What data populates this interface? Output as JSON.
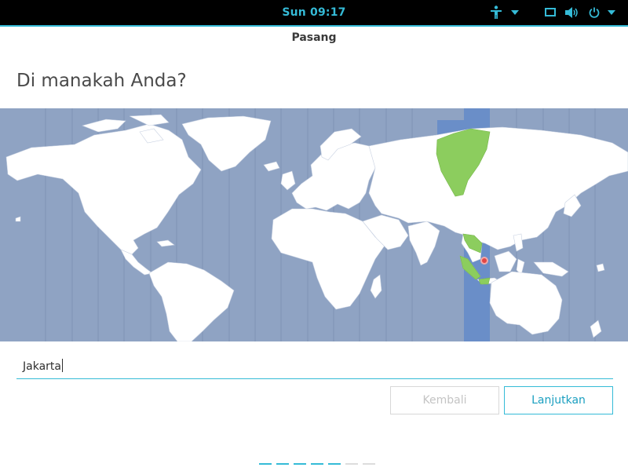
{
  "panel": {
    "clock": "Sun 09:17",
    "icons": [
      "accessibility-icon",
      "chevron-down-icon",
      "screen-icon",
      "volume-icon",
      "power-icon",
      "chevron-down-icon"
    ]
  },
  "window": {
    "title": "Pasang",
    "heading": "Di manakah Anda?"
  },
  "map": {
    "selected_zone_color": "#6a8ec8",
    "highlight_land_color": "#8ccd5e",
    "ocean_color": "#8fa3c3"
  },
  "search": {
    "value": "Jakarta"
  },
  "buttons": {
    "back": "Kembali",
    "next": "Lanjutkan"
  },
  "progress": {
    "total_steps": 7,
    "completed_steps": 5
  },
  "colors": {
    "accent": "#35bbd7"
  }
}
